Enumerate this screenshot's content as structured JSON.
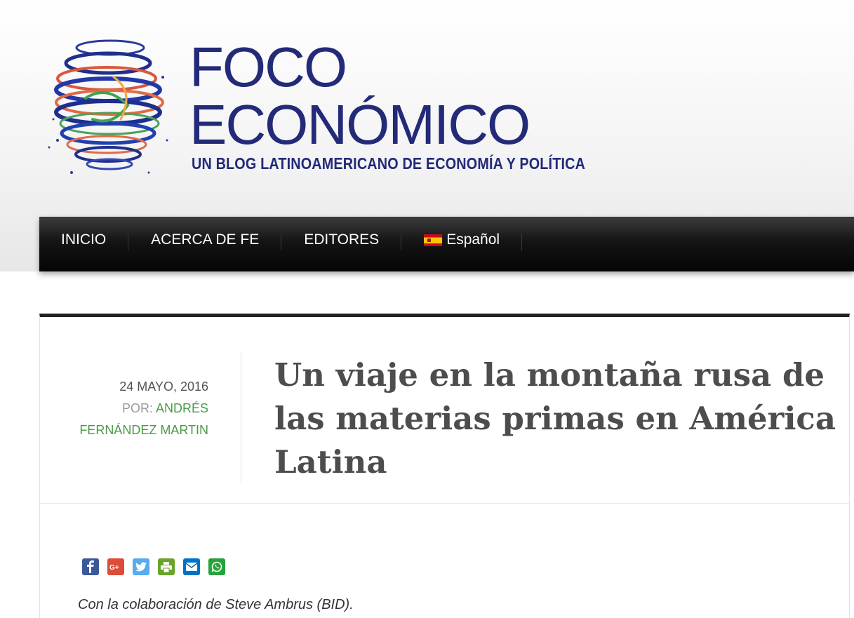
{
  "site": {
    "logo_line1": "FOCO",
    "logo_line2": "ECONÓMICO",
    "tagline": "UN BLOG LATINOAMERICANO DE ECONOMÍA Y POLÍTICA",
    "brand_color": "#232a78"
  },
  "nav": {
    "items": [
      {
        "label": "INICIO"
      },
      {
        "label": "ACERCA DE FE"
      },
      {
        "label": "EDITORES"
      },
      {
        "label": "Español",
        "icon": "spain-flag-icon"
      }
    ]
  },
  "post": {
    "date": "24 MAYO, 2016",
    "by_label": "POR:",
    "author_line1": "ANDRÉS",
    "author_line2": "FERNÁNDEZ MARTIN",
    "title": "Un viaje en la montaña rusa de las materias primas en América Latina",
    "collaboration": "Con la colaboración de Steve Ambrus (BID).",
    "author_color": "#4a9b47"
  },
  "share": {
    "buttons": [
      {
        "icon": "facebook-icon",
        "color": "#3b5998"
      },
      {
        "icon": "google-plus-icon",
        "color": "#dd4b39"
      },
      {
        "icon": "twitter-icon",
        "color": "#55acee"
      },
      {
        "icon": "print-icon",
        "color": "#6aa32a"
      },
      {
        "icon": "email-icon",
        "color": "#0072c6"
      },
      {
        "icon": "whatsapp-icon",
        "color": "#25a33a"
      }
    ]
  }
}
